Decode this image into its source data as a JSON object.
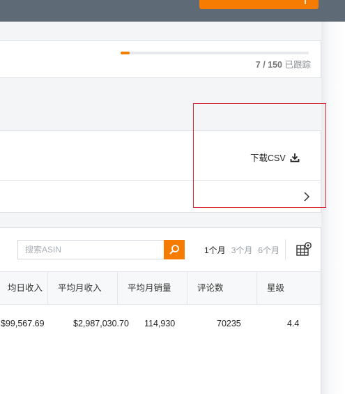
{
  "tracking": {
    "count": "7 / 150",
    "suffix": "已跟踪",
    "progress": 0.047
  },
  "csv": {
    "label": "下载CSV"
  },
  "table": {
    "search_placeholder": "搜索ASIN",
    "ranges": [
      "1个月",
      "3个月",
      "6个月"
    ],
    "active_range": "1个月",
    "headers": [
      "均日收入",
      "平均月收入",
      "平均月销量",
      "评论数",
      "星级"
    ],
    "rows": [
      [
        "$99,567.69",
        "$2,987,030.70",
        "114,930",
        "70235",
        "4.4"
      ]
    ]
  },
  "colors": {
    "accent": "#f57c00",
    "topbar": "#5e6b77",
    "highlight": "#d6232f"
  }
}
